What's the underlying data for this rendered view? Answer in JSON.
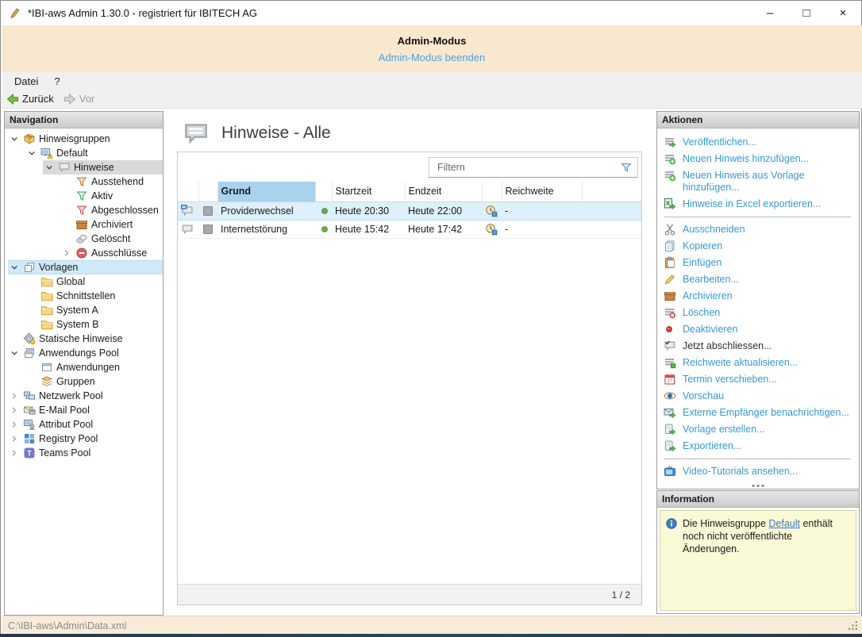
{
  "window": {
    "title": "*IBI-aws Admin 1.30.0 - registriert für IBITECH AG",
    "controls": {
      "minimize": "–",
      "maximize": "□",
      "close": "×"
    }
  },
  "banner": {
    "title": "Admin-Modus",
    "link": "Admin-Modus beenden"
  },
  "menu": {
    "items": [
      {
        "label": "Datei"
      },
      {
        "label": "?"
      }
    ]
  },
  "toolbar": {
    "back": "Zurück",
    "forward": "Vor"
  },
  "navigation": {
    "header": "Navigation",
    "tree": [
      {
        "label": "Hinweisgruppen",
        "level": 0,
        "chevron": "expanded",
        "icon": "package",
        "highlight": "none"
      },
      {
        "label": "Default",
        "level": 1,
        "chevron": "expanded",
        "icon": "monitor-warning",
        "highlight": "none"
      },
      {
        "label": "Hinweise",
        "level": 2,
        "chevron": "expanded",
        "icon": "notes",
        "highlight": "gray"
      },
      {
        "label": "Ausstehend",
        "level": 3,
        "chevron": "none",
        "icon": "funnel-orange",
        "highlight": "none"
      },
      {
        "label": "Aktiv",
        "level": 3,
        "chevron": "none",
        "icon": "funnel-green",
        "highlight": "none"
      },
      {
        "label": "Abgeschlossen",
        "level": 3,
        "chevron": "none",
        "icon": "funnel-red",
        "highlight": "none"
      },
      {
        "label": "Archiviert",
        "level": 3,
        "chevron": "none",
        "icon": "archive-box",
        "highlight": "none"
      },
      {
        "label": "Gelöscht",
        "level": 3,
        "chevron": "none",
        "icon": "deleted",
        "highlight": "none"
      },
      {
        "label": "Ausschlüsse",
        "level": 3,
        "chevron": "collapsed",
        "icon": "exclusion",
        "highlight": "none"
      },
      {
        "label": "Vorlagen",
        "level": 0,
        "chevron": "expanded",
        "icon": "templates",
        "highlight": "blue"
      },
      {
        "label": "Global",
        "level": 1,
        "chevron": "none",
        "icon": "folder",
        "highlight": "none"
      },
      {
        "label": "Schnittstellen",
        "level": 1,
        "chevron": "none",
        "icon": "folder",
        "highlight": "none"
      },
      {
        "label": "System A",
        "level": 1,
        "chevron": "none",
        "icon": "folder",
        "highlight": "none"
      },
      {
        "label": "System B",
        "level": 1,
        "chevron": "none",
        "icon": "folder",
        "highlight": "none"
      },
      {
        "label": "Statische Hinweise",
        "level": 0,
        "chevron": "none",
        "icon": "static-gear",
        "highlight": "none"
      },
      {
        "label": "Anwendungs Pool",
        "level": 0,
        "chevron": "expanded",
        "icon": "app-pool",
        "highlight": "none"
      },
      {
        "label": "Anwendungen",
        "level": 1,
        "chevron": "none",
        "icon": "window",
        "highlight": "none"
      },
      {
        "label": "Gruppen",
        "level": 1,
        "chevron": "none",
        "icon": "groups",
        "highlight": "none"
      },
      {
        "label": "Netzwerk Pool",
        "level": 0,
        "chevron": "collapsed",
        "icon": "network",
        "highlight": "none"
      },
      {
        "label": "E-Mail Pool",
        "level": 0,
        "chevron": "collapsed",
        "icon": "email",
        "highlight": "none"
      },
      {
        "label": "Attribut Pool",
        "level": 0,
        "chevron": "collapsed",
        "icon": "attribute",
        "highlight": "none"
      },
      {
        "label": "Registry Pool",
        "level": 0,
        "chevron": "collapsed",
        "icon": "registry",
        "highlight": "none"
      },
      {
        "label": "Teams Pool",
        "level": 0,
        "chevron": "collapsed",
        "icon": "teams",
        "highlight": "none"
      }
    ]
  },
  "content": {
    "title": "Hinweise - Alle",
    "filter_placeholder": "Filtern",
    "table": {
      "columns": [
        "Grund",
        "Startzeit",
        "Endzeit",
        "Reichweite"
      ],
      "rows": [
        {
          "icon": "note-monitor",
          "grund": "Providerwechsel",
          "status": "green",
          "startzeit": "Heute 20:30",
          "endzeit": "Heute 22:00",
          "reichweite": "-",
          "selected": true
        },
        {
          "icon": "note-bubble",
          "grund": "Internetstörung",
          "status": "green",
          "startzeit": "Heute 15:42",
          "endzeit": "Heute 17:42",
          "reichweite": "-",
          "selected": false
        }
      ]
    },
    "pagination": "1 / 2"
  },
  "actions": {
    "header": "Aktionen",
    "groups": [
      [
        {
          "label": "Veröffentlichen...",
          "icon": "publish"
        },
        {
          "label": "Neuen Hinweis hinzufügen...",
          "icon": "note-add"
        },
        {
          "label": "Neuen Hinweis aus Vorlage hinzufügen...",
          "icon": "note-add"
        },
        {
          "label": "Hinweise in Excel exportieren...",
          "icon": "excel-export"
        }
      ],
      [
        {
          "label": "Ausschneiden",
          "icon": "cut"
        },
        {
          "label": "Kopieren",
          "icon": "copy"
        },
        {
          "label": "Einfügen",
          "icon": "paste"
        },
        {
          "label": "Bearbeiten...",
          "icon": "edit"
        },
        {
          "label": "Archivieren",
          "icon": "archive-box"
        },
        {
          "label": "Löschen",
          "icon": "delete"
        },
        {
          "label": "Deaktivieren",
          "icon": "deactivate"
        },
        {
          "label": "Jetzt abschliessen...",
          "icon": "finish-check",
          "dark": true
        },
        {
          "label": "Reichweite aktualisieren...",
          "icon": "reach-update"
        },
        {
          "label": "Termin verschieben...",
          "icon": "calendar-move"
        },
        {
          "label": "Vorschau",
          "icon": "eye"
        },
        {
          "label": "Externe Empfänger benachrichtigen...",
          "icon": "mail-notify"
        },
        {
          "label": "Vorlage erstellen...",
          "icon": "export-doc"
        },
        {
          "label": "Exportieren...",
          "icon": "export-doc"
        }
      ],
      [
        {
          "label": "Video-Tutorials ansehen...",
          "icon": "video"
        }
      ]
    ]
  },
  "information": {
    "header": "Information",
    "text_before": "Die Hinweisgruppe ",
    "link": "Default",
    "text_after": " enthält noch nicht veröffentlichte Änderungen."
  },
  "statusbar": {
    "path": "C:\\IBI-aws\\Admin\\Data.xml"
  },
  "colors": {
    "banner_bg": "#f8e8d0",
    "action_link": "#3598d4",
    "banner_link": "#4da0dc",
    "info_bg": "#fbfad6",
    "grund_header_bg": "#a9d2ee",
    "selected_row_bg": "#ddf0fb",
    "tree_selection_gray": "#d9d9d9",
    "tree_selection_blue": "#cfe9f8",
    "status_dot_green": "#6ab04c",
    "statusbar_bg": "#f8ecd9"
  }
}
